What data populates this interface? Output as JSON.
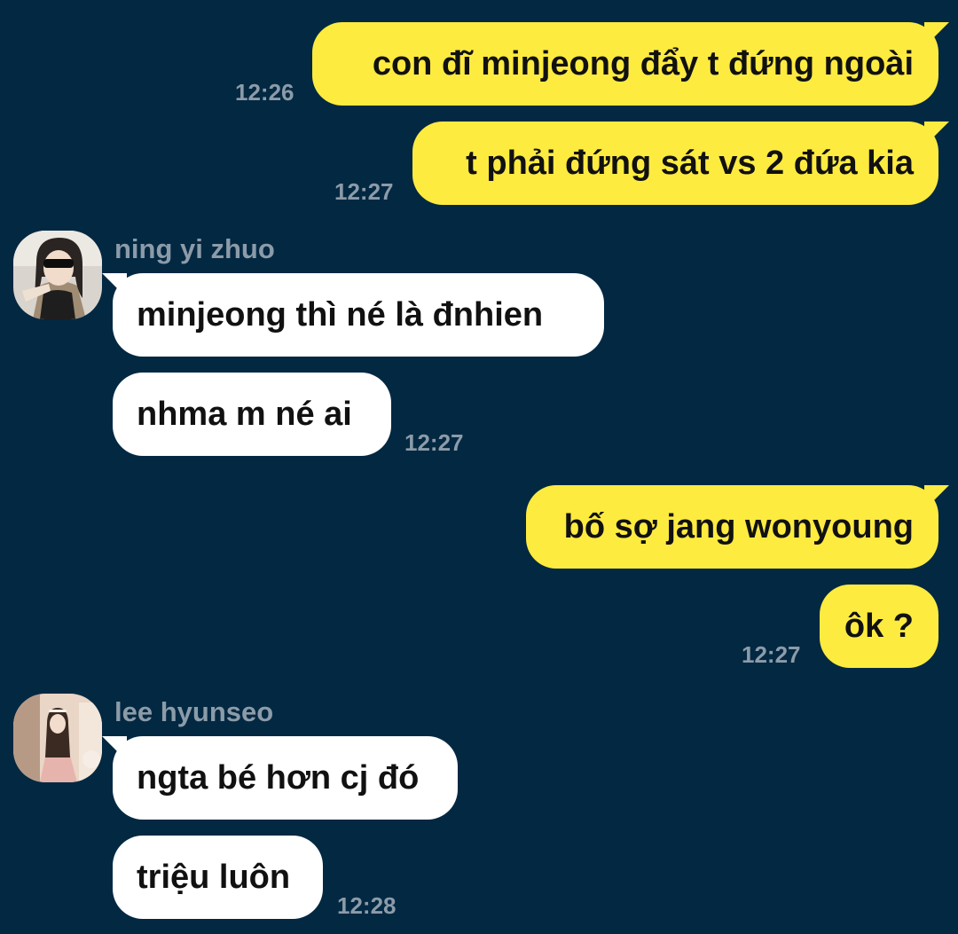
{
  "conversation": [
    {
      "type": "outgoing",
      "text": "con đĩ minjeong đẩy t đứng ngoài",
      "time": "12:26"
    },
    {
      "type": "outgoing",
      "text": "t phải đứng sát vs 2 đứa kia",
      "time": "12:27"
    },
    {
      "type": "sender",
      "name": "ning yi zhuo",
      "avatar": "avatar-photo-woman-sunglasses"
    },
    {
      "type": "incoming",
      "text": "minjeong thì né là đnhien"
    },
    {
      "type": "incoming",
      "text": "nhma m né ai",
      "time": "12:27"
    },
    {
      "type": "outgoing",
      "text": "bố sợ jang wonyoung"
    },
    {
      "type": "outgoing",
      "text": "ôk ?",
      "time": "12:27"
    },
    {
      "type": "sender",
      "name": "lee hyunseo",
      "avatar": "avatar-photo-woman-pink-dress"
    },
    {
      "type": "incoming",
      "text": "ngta bé hơn cj đó"
    },
    {
      "type": "incoming",
      "text": "triệu luôn",
      "time": "12:28"
    }
  ],
  "colors": {
    "background": "#022842",
    "outgoing_bubble": "#FEEB40",
    "incoming_bubble": "#FFFFFF",
    "timestamp": "#8C9BA8",
    "sender_name": "#8C9BA8",
    "message_text": "#111111"
  }
}
